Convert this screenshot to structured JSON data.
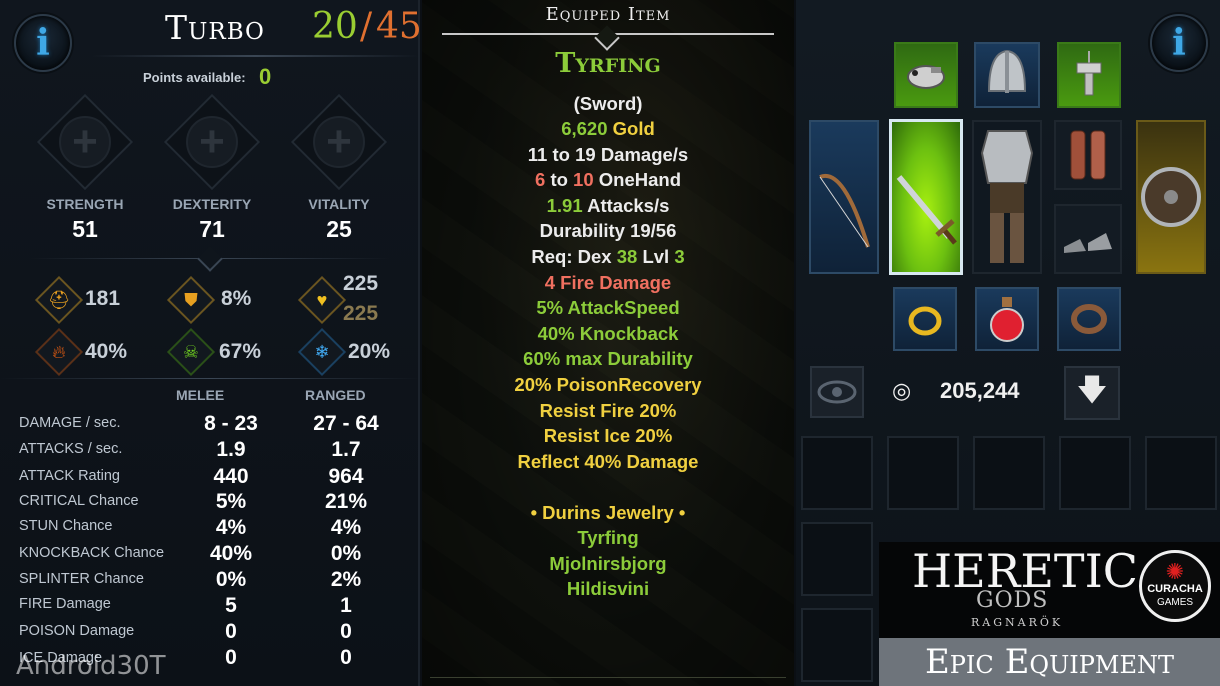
{
  "character": {
    "name": "Turbo",
    "level_current": "20",
    "level_sep": "/",
    "level_max": "45",
    "points_label": "Points available:",
    "points_value": "0"
  },
  "attributes": [
    {
      "label": "STRENGTH",
      "value": "51"
    },
    {
      "label": "DEXTERITY",
      "value": "71"
    },
    {
      "label": "VITALITY",
      "value": "25"
    }
  ],
  "defense_stats": {
    "armor": "181",
    "block": "8%",
    "health_current": "225",
    "health_max": "225",
    "fire_res": "40%",
    "poison_res": "67%",
    "ice_res": "20%"
  },
  "combat": {
    "head_melee": "MELEE",
    "head_ranged": "RANGED",
    "rows": [
      {
        "label": "DAMAGE / sec.",
        "melee": "8 - 23",
        "ranged": "27 - 64"
      },
      {
        "label": "ATTACKS / sec.",
        "melee": "1.9",
        "ranged": "1.7"
      },
      {
        "label": "ATTACK Rating",
        "melee": "440",
        "ranged": "964"
      },
      {
        "label": "CRITICAL Chance",
        "melee": "5%",
        "ranged": "21%"
      },
      {
        "label": "STUN Chance",
        "melee": "4%",
        "ranged": "4%"
      },
      {
        "label": "KNOCKBACK Chance",
        "melee": "40%",
        "ranged": "0%"
      },
      {
        "label": "SPLINTER Chance",
        "melee": "0%",
        "ranged": "2%"
      },
      {
        "label": "FIRE Damage",
        "melee": "5",
        "ranged": "1"
      },
      {
        "label": "POISON Damage",
        "melee": "0",
        "ranged": "0"
      },
      {
        "label": "ICE Damage",
        "melee": "0",
        "ranged": "0"
      }
    ]
  },
  "equipped": {
    "title": "Equiped Item",
    "name": "Tyrfing",
    "type": "(Sword)",
    "gold": "6,620",
    "gold_label": "Gold",
    "dmg_min": "11",
    "dmg_to": "to",
    "dmg_max": "19",
    "dmg_label": "Damage/s",
    "hand_min": "6",
    "hand_to": "to",
    "hand_max": "10",
    "hand_label": "OneHand",
    "aps_value": "1.91",
    "aps_label": "Attacks/s",
    "durability": "Durability 19/56",
    "req_prefix": "Req: Dex",
    "req_dex": "38",
    "req_lvl_label": "Lvl",
    "req_lvl": "3",
    "affixes": [
      "4 Fire Damage",
      "5% AttackSpeed",
      "40% Knockback",
      "60% max Durability",
      "20% PoisonRecovery",
      "Resist Fire 20%",
      "Resist Ice 20%",
      "Reflect 40% Damage"
    ],
    "set_name": "• Durins Jewelry •",
    "set_items": [
      "Tyrfing",
      "Mjolnirsbjorg",
      "Hildisvini"
    ]
  },
  "inventory": {
    "gold": "205,244"
  },
  "branding": {
    "logo_line1": "HERETIC",
    "logo_line2": "GODS",
    "logo_line3": "RAGNARÖK",
    "publisher_line1": "CURACHA",
    "publisher_line2": "GAMES",
    "caption": "Epic Equipment"
  },
  "watermark": "Android30T",
  "icons": {
    "info": "info-icon",
    "plus": "plus-icon",
    "helmet": "helmet-icon",
    "shield": "shield-icon",
    "heart": "heart-icon",
    "fire": "fire-icon",
    "skull": "skull-icon",
    "snowflake": "snowflake-icon",
    "eye": "eye-icon",
    "coins": "coins-icon",
    "arrow_down": "arrow-down-icon"
  },
  "colors": {
    "level_green": "#9acd32",
    "level_orange": "#e07030",
    "item_green": "#8ccc3a",
    "item_red": "#f07060",
    "item_yellow": "#f0d040"
  }
}
